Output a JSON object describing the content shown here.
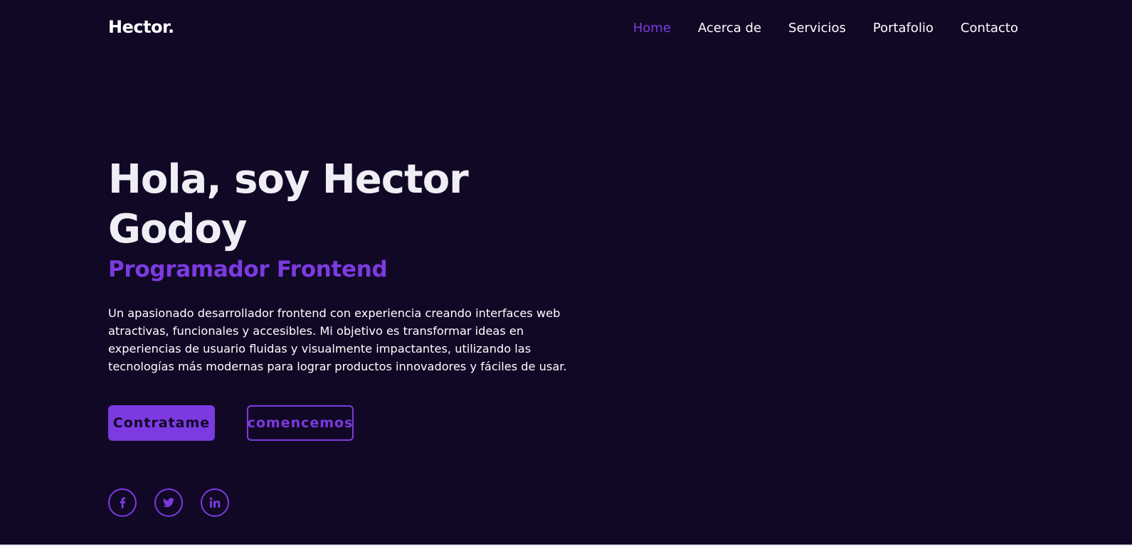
{
  "header": {
    "logo": "Hector.",
    "nav": [
      {
        "label": "Home",
        "active": true
      },
      {
        "label": "Acerca de",
        "active": false
      },
      {
        "label": "Servicios",
        "active": false
      },
      {
        "label": "Portafolio",
        "active": false
      },
      {
        "label": "Contacto",
        "active": false
      }
    ]
  },
  "hero": {
    "title": "Hola, soy Hector Godoy",
    "subtitle": "Programador Frontend",
    "description": "Un apasionado desarrollador frontend con experiencia creando interfaces web atractivas, funcionales y accesibles. Mi objetivo es transformar ideas en experiencias de usuario fluidas y visualmente impactantes, utilizando las tecnologías más modernas para lograr productos innovadores y fáciles de usar.",
    "primary_button": "Contratame",
    "secondary_button": "comencemos"
  },
  "social": [
    {
      "icon": "facebook-icon"
    },
    {
      "icon": "twitter-icon"
    },
    {
      "icon": "linkedin-icon"
    }
  ],
  "colors": {
    "background": "#110826",
    "accent": "#7c3ae0",
    "text": "#ffffff"
  }
}
